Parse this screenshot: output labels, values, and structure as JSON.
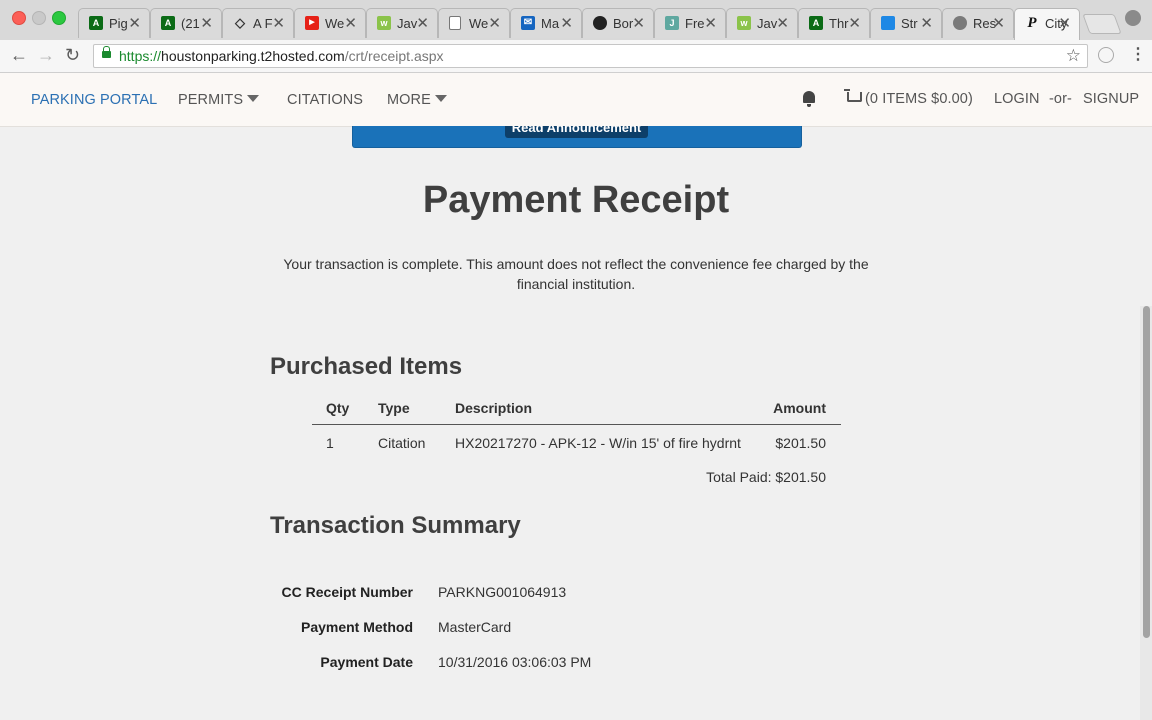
{
  "browser": {
    "tabs": [
      {
        "title": "Pig",
        "icon": "green-square-icon",
        "color": "#0b6b16"
      },
      {
        "title": "(21",
        "icon": "green-square-icon",
        "color": "#0b6b16"
      },
      {
        "title": "A F",
        "icon": "codepen-icon",
        "color": "#333333"
      },
      {
        "title": "We",
        "icon": "youtube-icon",
        "color": "#e62117"
      },
      {
        "title": "Jav",
        "icon": "w3-icon",
        "color": "#8bc34a"
      },
      {
        "title": "We",
        "icon": "page-icon",
        "color": "#ffffff"
      },
      {
        "title": "Ma",
        "icon": "mail-icon",
        "color": "#1565c0"
      },
      {
        "title": "Bor",
        "icon": "github-icon",
        "color": "#222222"
      },
      {
        "title": "Fre",
        "icon": "freecodecamp-icon",
        "color": "#5fa8a0"
      },
      {
        "title": "Jav",
        "icon": "w3-icon",
        "color": "#8bc34a"
      },
      {
        "title": "Thr",
        "icon": "green-square-icon",
        "color": "#0b6b16"
      },
      {
        "title": "Str",
        "icon": "stackoverflow-icon",
        "color": "#1e88e5"
      },
      {
        "title": "Res",
        "icon": "avatar-icon",
        "color": "#7a7a7a"
      },
      {
        "title": "City",
        "icon": "parking-p-icon",
        "color": "#ffffff",
        "active": true
      }
    ],
    "url_scheme": "https://",
    "url_host": "houstonparking.t2hosted.com",
    "url_path": "/crt/receipt.aspx"
  },
  "nav": {
    "brand": "PARKING PORTAL",
    "permits": "PERMITS",
    "citations": "CITATIONS",
    "more": "MORE",
    "cart": "(0 ITEMS $0.00)",
    "login": "LOGIN",
    "or": "-or-",
    "signup": "SIGNUP"
  },
  "announcement": {
    "button": "Read Announcement"
  },
  "page": {
    "title": "Payment Receipt",
    "intro": "Your transaction is complete. This amount does not reflect the convenience fee charged by the financial institution."
  },
  "purchased": {
    "heading": "Purchased Items",
    "columns": {
      "qty": "Qty",
      "type": "Type",
      "description": "Description",
      "amount": "Amount"
    },
    "rows": [
      {
        "qty": "1",
        "type": "Citation",
        "description": "HX20217270 - APK-12 - W/in 15' of fire hydrnt",
        "amount": "$201.50"
      }
    ],
    "total": "Total Paid: $201.50"
  },
  "summary": {
    "heading": "Transaction Summary",
    "rows": [
      {
        "label": "CC Receipt Number",
        "value": "PARKNG001064913"
      },
      {
        "label": "Payment Method",
        "value": "MasterCard"
      },
      {
        "label": "Payment Date",
        "value": "10/31/2016 03:06:03 PM"
      }
    ]
  }
}
